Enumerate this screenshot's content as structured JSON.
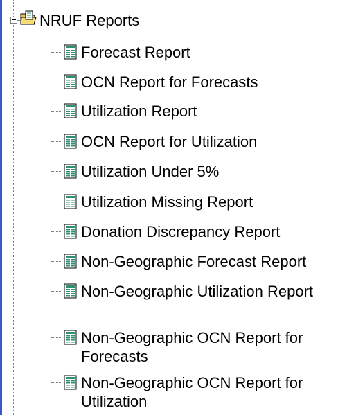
{
  "tree": {
    "root": {
      "label": "NRUF Reports",
      "expanded": true,
      "icon": "report-folder-icon"
    },
    "items": [
      {
        "label": "Forecast Report",
        "icon": "report-icon"
      },
      {
        "label": "OCN Report for Forecasts",
        "icon": "report-icon"
      },
      {
        "label": "Utilization Report",
        "icon": "report-icon"
      },
      {
        "label": "OCN Report for Utilization",
        "icon": "report-icon"
      },
      {
        "label": "Utilization Under 5%",
        "icon": "report-icon"
      },
      {
        "label": "Utilization Missing Report",
        "icon": "report-icon"
      },
      {
        "label": "Donation Discrepancy Report",
        "icon": "report-icon"
      },
      {
        "label": "Non-Geographic Forecast Report",
        "icon": "report-icon"
      },
      {
        "label": "Non-Geographic Utilization Report",
        "icon": "report-icon"
      },
      {
        "label": "Non-Geographic OCN Report for Forecasts",
        "icon": "report-icon"
      },
      {
        "label": "Non-Geographic OCN Report for Utilization",
        "icon": "report-icon"
      }
    ]
  },
  "colors": {
    "accent_bar": "#3a58c9",
    "tree_line": "#808080",
    "icon_fill": "#2f8f72",
    "folder_fill": "#e8c44a"
  }
}
